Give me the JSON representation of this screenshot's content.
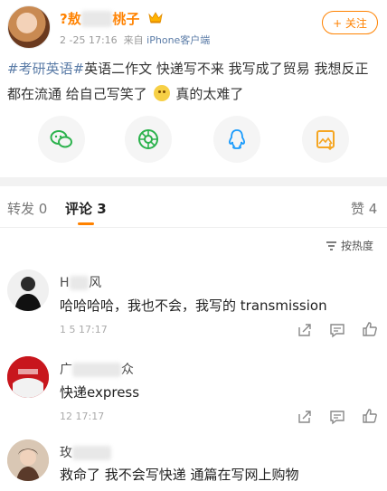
{
  "post": {
    "username_start": "?敖",
    "username_end": "桃子",
    "time": "2 -25 17:16",
    "source_prefix": "来自",
    "source": "iPhone客户端",
    "follow_label": "+ 关注",
    "tag1": "#考研英语#",
    "text_part1": "英语二作文 快递写不来 我写成了贸易 我想反正都在流通 给自己写笑了",
    "text_part2": "真的太难了",
    "share_icons": [
      "wechat-icon",
      "moments-icon",
      "qq-icon",
      "save-image-icon"
    ]
  },
  "tabs": {
    "repost": "转发 0",
    "comment": "评论 3",
    "like": "赞 4"
  },
  "sort_label": "按热度",
  "comments": [
    {
      "name_start": "H",
      "name_end": "风",
      "text": "哈哈哈哈，我也不会，我写的 transmission",
      "time": "1 5 17:17"
    },
    {
      "name_start": "广",
      "name_end": "众",
      "text": "快递express",
      "time": "12 17:17"
    },
    {
      "name_start": "玫",
      "name_end": "",
      "text": "救命了 我不会写快递 通篇在写网上购物",
      "time": ""
    }
  ],
  "colors": {
    "accent": "#ff8200",
    "link": "#5b7ca7",
    "wechat": "#2bb24c",
    "qq": "#1a9bfc"
  }
}
